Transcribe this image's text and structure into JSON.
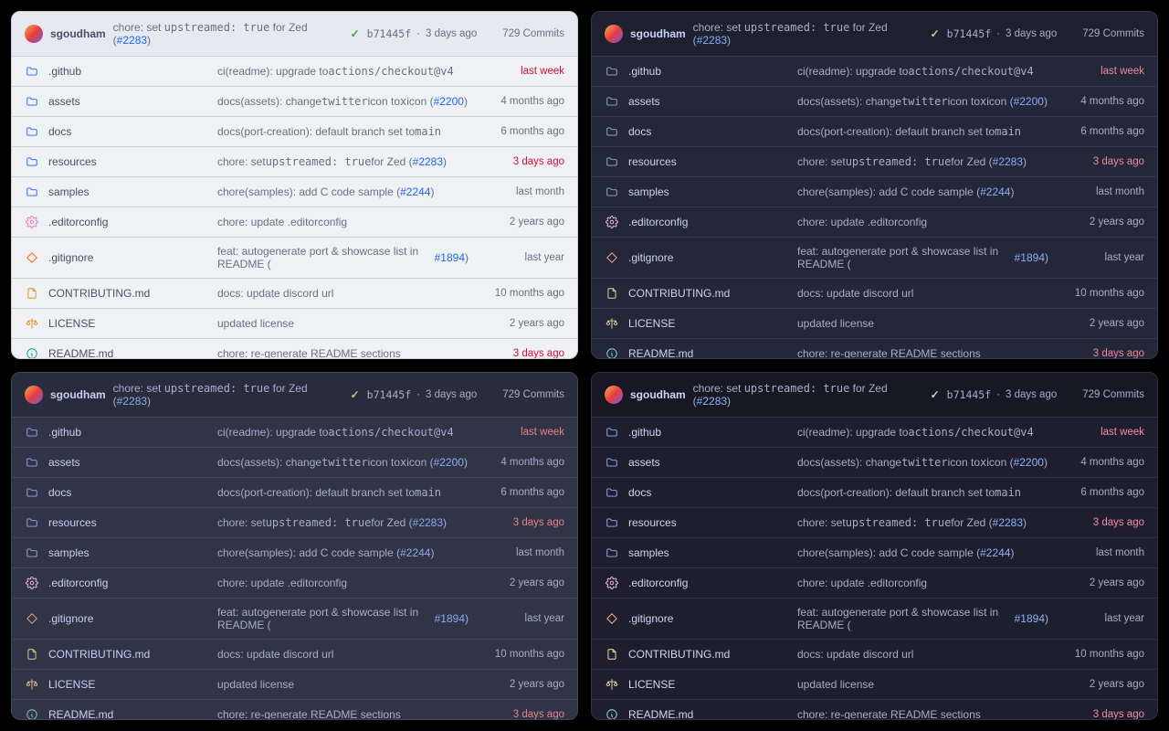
{
  "themes": [
    "t-latte",
    "t-macchiato",
    "t-frappe",
    "t-mocha"
  ],
  "header": {
    "author": "sgoudham",
    "msg_pre": "chore: set ",
    "msg_mono": "upstreamed: true",
    "msg_post": " for Zed (",
    "issue": "#2283",
    "close": ")",
    "hash": "b71445f",
    "sep": " · ",
    "age": "3 days ago",
    "commits": "729 Commits"
  },
  "rows": [
    {
      "icon": "folder",
      "name": ".github",
      "msg": [
        {
          "t": "ci(readme): upgrade to "
        },
        {
          "t": "actions/checkout@v4",
          "mono": true
        }
      ],
      "age": "last week",
      "emph": true
    },
    {
      "icon": "folder",
      "name": "assets",
      "msg": [
        {
          "t": "docs(assets): change "
        },
        {
          "t": "twitter",
          "mono": true
        },
        {
          "t": " icon to "
        },
        {
          "t": "x",
          "mono": true
        },
        {
          "t": " icon ("
        },
        {
          "t": "#2200",
          "link": true
        },
        {
          "t": ")"
        }
      ],
      "age": "4 months ago"
    },
    {
      "icon": "folder",
      "name": "docs",
      "msg": [
        {
          "t": "docs(port-creation): default branch set to "
        },
        {
          "t": "main",
          "mono": true
        }
      ],
      "age": "6 months ago"
    },
    {
      "icon": "folder",
      "name": "resources",
      "msg": [
        {
          "t": "chore: set "
        },
        {
          "t": "upstreamed: true",
          "mono": true
        },
        {
          "t": " for Zed ("
        },
        {
          "t": "#2283",
          "link": true
        },
        {
          "t": ")"
        }
      ],
      "age": "3 days ago",
      "emph": true
    },
    {
      "icon": "folder",
      "name": "samples",
      "msg": [
        {
          "t": "chore(samples): add C code sample ("
        },
        {
          "t": "#2244",
          "link": true
        },
        {
          "t": ")"
        }
      ],
      "age": "last month"
    },
    {
      "icon": "gear",
      "name": ".editorconfig",
      "msg": [
        {
          "t": "chore: update .editorconfig"
        }
      ],
      "age": "2 years ago"
    },
    {
      "icon": "diamond",
      "name": ".gitignore",
      "msg": [
        {
          "t": "feat: autogenerate port & showcase list in README ("
        },
        {
          "t": "#1894",
          "link": true
        },
        {
          "t": ")"
        }
      ],
      "age": "last year"
    },
    {
      "icon": "doc",
      "name": "CONTRIBUTING.md",
      "msg": [
        {
          "t": "docs: update discord url"
        }
      ],
      "age": "10 months ago"
    },
    {
      "icon": "scale",
      "name": "LICENSE",
      "msg": [
        {
          "t": "updated license"
        }
      ],
      "age": "2 years ago"
    },
    {
      "icon": "info",
      "name": "README.md",
      "msg": [
        {
          "t": "chore: re-generate README sections"
        }
      ],
      "age": "3 days ago",
      "emph": true
    }
  ]
}
